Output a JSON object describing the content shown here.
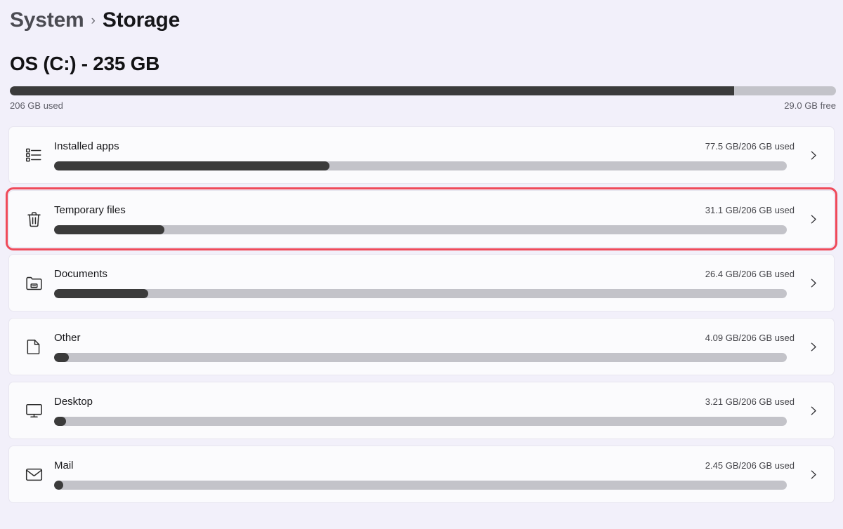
{
  "breadcrumb": {
    "parent": "System",
    "separator": "›",
    "current": "Storage"
  },
  "drive": {
    "title": "OS (C:) - 235 GB",
    "used_label": "206 GB used",
    "free_label": "29.0 GB free",
    "used_percent": 87.7,
    "capacity_gb": 235,
    "used_gb": 206,
    "free_gb": 29.0
  },
  "colors": {
    "page_background": "#f2f0fa",
    "card_background": "#fbfbfd",
    "bar_track": "#c3c3c9",
    "bar_fill": "#3b3b3b",
    "highlight": "#ef4a5a",
    "text_primary": "#17171a",
    "text_secondary": "#5d5d66"
  },
  "categories": [
    {
      "label": "Installed apps",
      "usage": "77.5 GB/206 GB used",
      "used_gb": 77.5,
      "total_gb": 206,
      "percent": 37.6,
      "icon": "app-list-icon",
      "highlighted": false,
      "chevron": "chevron-right-icon"
    },
    {
      "label": "Temporary files",
      "usage": "31.1 GB/206 GB used",
      "used_gb": 31.1,
      "total_gb": 206,
      "percent": 15.1,
      "icon": "trash-icon",
      "highlighted": true,
      "chevron": "chevron-right-icon"
    },
    {
      "label": "Documents",
      "usage": "26.4 GB/206 GB used",
      "used_gb": 26.4,
      "total_gb": 206,
      "percent": 12.8,
      "icon": "documents-folder-icon",
      "highlighted": false,
      "chevron": "chevron-right-icon"
    },
    {
      "label": "Other",
      "usage": "4.09 GB/206 GB used",
      "used_gb": 4.09,
      "total_gb": 206,
      "percent": 2.0,
      "icon": "page-icon",
      "highlighted": false,
      "chevron": "chevron-right-icon"
    },
    {
      "label": "Desktop",
      "usage": "3.21 GB/206 GB used",
      "used_gb": 3.21,
      "total_gb": 206,
      "percent": 1.6,
      "icon": "monitor-icon",
      "highlighted": false,
      "chevron": "chevron-right-icon"
    },
    {
      "label": "Mail",
      "usage": "2.45 GB/206 GB used",
      "used_gb": 2.45,
      "total_gb": 206,
      "percent": 1.2,
      "icon": "envelope-icon",
      "highlighted": false,
      "chevron": "chevron-right-icon"
    }
  ]
}
